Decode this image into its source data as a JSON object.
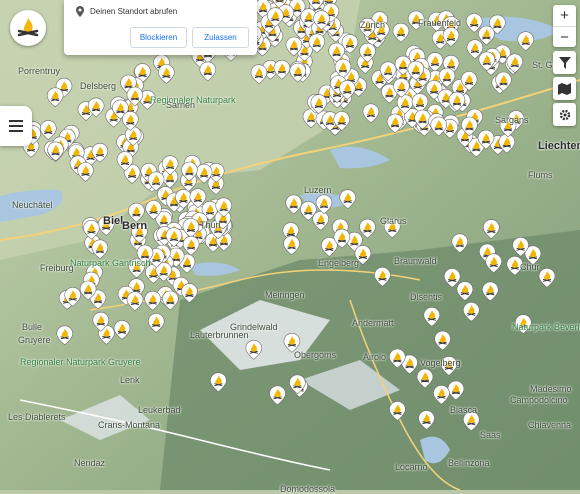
{
  "permission": {
    "text": "Deinen Standort abrufen",
    "block_label": "Blockieren",
    "allow_label": "Zulassen"
  },
  "controls": {
    "zoom_in": "+",
    "zoom_out": "−"
  },
  "places": [
    {
      "label": "Porrentruy",
      "cls": "place"
    },
    {
      "label": "Delsberg",
      "cls": "place"
    },
    {
      "label": "Regionaler Naturpark",
      "cls": "place park"
    },
    {
      "label": "Frauenfeld",
      "cls": "place"
    },
    {
      "label": "St. Gallen",
      "cls": "place"
    },
    {
      "label": "Liechtenstein",
      "cls": "place city"
    },
    {
      "label": "Biel",
      "cls": "place city"
    },
    {
      "label": "Neuchâtel",
      "cls": "place"
    },
    {
      "label": "Freiburg",
      "cls": "place"
    },
    {
      "label": "Naturpark Gantrisch",
      "cls": "place park"
    },
    {
      "label": "Meiringen",
      "cls": "place"
    },
    {
      "label": "Engelberg",
      "cls": "place"
    },
    {
      "label": "Glarus",
      "cls": "place"
    },
    {
      "label": "Braunwald",
      "cls": "place"
    },
    {
      "label": "Andermatt",
      "cls": "place"
    },
    {
      "label": "Disentis",
      "cls": "place"
    },
    {
      "label": "Naturpark Beverin",
      "cls": "place park"
    },
    {
      "label": "Bulle",
      "cls": "place"
    },
    {
      "label": "Gruyère",
      "cls": "place"
    },
    {
      "label": "Regionaler Naturpark Gruyère",
      "cls": "place park"
    },
    {
      "label": "Lauterbrunnen",
      "cls": "place"
    },
    {
      "label": "Grindelwald",
      "cls": "place"
    },
    {
      "label": "Obergoms",
      "cls": "place"
    },
    {
      "label": "Airolo",
      "cls": "place"
    },
    {
      "label": "Leukerbad",
      "cls": "place"
    },
    {
      "label": "Crans-Montana",
      "cls": "place"
    },
    {
      "label": "Les Diablerets",
      "cls": "place"
    },
    {
      "label": "Vogelberg",
      "cls": "place"
    },
    {
      "label": "Biasca",
      "cls": "place"
    },
    {
      "label": "Bellinzona",
      "cls": "place"
    },
    {
      "label": "Locarno",
      "cls": "place"
    },
    {
      "label": "Madesimo",
      "cls": "place"
    },
    {
      "label": "Campodolcino",
      "cls": "place"
    },
    {
      "label": "Chiavenna",
      "cls": "place"
    },
    {
      "label": "Domodossola",
      "cls": "place"
    },
    {
      "label": "Nendaz",
      "cls": "place"
    },
    {
      "label": "Sarnen",
      "cls": "place"
    },
    {
      "label": "Flums",
      "cls": "place"
    },
    {
      "label": "Sargans",
      "cls": "place"
    },
    {
      "label": "Chur",
      "cls": "place"
    },
    {
      "label": "Thun",
      "cls": "place"
    },
    {
      "label": "Bern",
      "cls": "place city"
    },
    {
      "label": "Luzern",
      "cls": "place"
    },
    {
      "label": "Zürich",
      "cls": "place"
    },
    {
      "label": "Lenk",
      "cls": "place"
    },
    {
      "label": "Saas",
      "cls": "place"
    }
  ],
  "colors": {
    "pin_fill": "#f2b705",
    "pin_border": "#ffffff",
    "accent": "#1a73e8"
  }
}
